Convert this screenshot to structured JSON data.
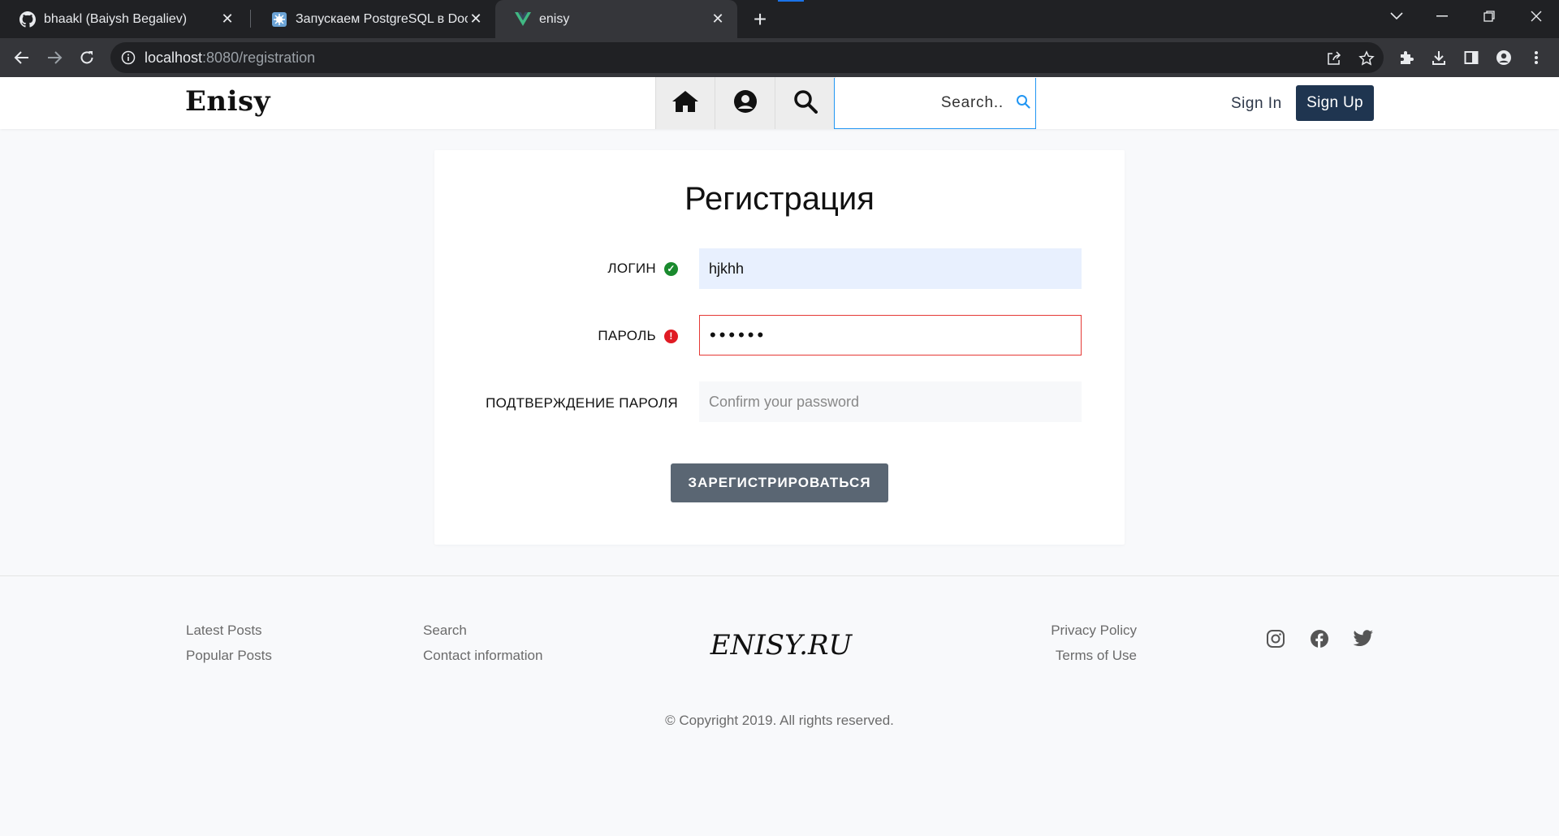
{
  "browser": {
    "tabs": [
      {
        "title": "bhaakl (Baiysh Begaliev)",
        "favicon": "github-icon"
      },
      {
        "title": "Запускаем PostgreSQL в Docker",
        "favicon": "habr-icon"
      },
      {
        "title": "enisy",
        "favicon": "vue-icon"
      }
    ],
    "url_host": "localhost",
    "url_path": ":8080/registration"
  },
  "header": {
    "logo": "Enisy",
    "search_placeholder": "Search..",
    "signin_label": "Sign In",
    "signup_label": "Sign Up"
  },
  "form": {
    "title": "Регистрация",
    "login_label": "ЛОГИН",
    "login_value": "hjkhh",
    "login_status": "valid",
    "password_label": "ПАРОЛЬ",
    "password_value": "••••••",
    "password_status": "invalid",
    "confirm_label": "ПОДТВЕРЖДЕНИЕ ПАРОЛЯ",
    "confirm_placeholder": "Confirm your password",
    "submit_label": "ЗАРЕГИСТРИРОВАТЬСЯ"
  },
  "footer": {
    "col1": [
      "Latest Posts",
      "Popular Posts"
    ],
    "col2": [
      "Search",
      "Contact information"
    ],
    "logo_text": "ENISY.RU",
    "col3": [
      "Privacy Policy",
      "Terms of Use"
    ],
    "social": [
      "instagram-icon",
      "facebook-icon",
      "twitter-icon"
    ],
    "copyright": "© Copyright 2019. All rights reserved."
  },
  "colors": {
    "brand_dark": "#1f3550",
    "valid": "#1a8a2e",
    "invalid": "#e01b24",
    "search_accent": "#2196f3"
  }
}
